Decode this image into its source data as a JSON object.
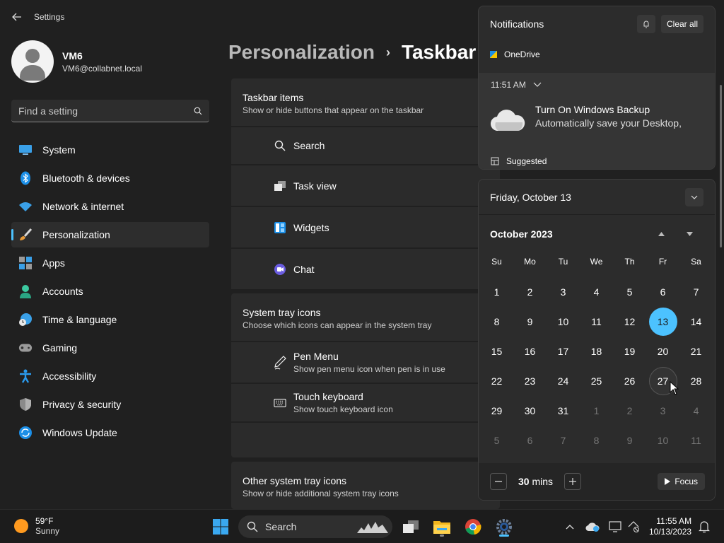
{
  "window": {
    "title": "Settings"
  },
  "profile": {
    "name": "VM6",
    "email": "VM6@collabnet.local"
  },
  "search": {
    "placeholder": "Find a setting"
  },
  "sidebar": {
    "items": [
      {
        "label": "System",
        "icon": "monitor-icon"
      },
      {
        "label": "Bluetooth & devices",
        "icon": "bluetooth-icon"
      },
      {
        "label": "Network & internet",
        "icon": "wifi-icon"
      },
      {
        "label": "Personalization",
        "icon": "brush-icon",
        "active": true
      },
      {
        "label": "Apps",
        "icon": "apps-icon"
      },
      {
        "label": "Accounts",
        "icon": "person-icon"
      },
      {
        "label": "Time & language",
        "icon": "clock-globe-icon"
      },
      {
        "label": "Gaming",
        "icon": "gamepad-icon"
      },
      {
        "label": "Accessibility",
        "icon": "accessibility-icon"
      },
      {
        "label": "Privacy & security",
        "icon": "shield-icon"
      },
      {
        "label": "Windows Update",
        "icon": "update-icon"
      }
    ]
  },
  "header": {
    "parent": "Personalization",
    "current": "Taskbar"
  },
  "taskbar_items": {
    "title": "Taskbar items",
    "subtitle": "Show or hide buttons that appear on the taskbar",
    "rows": [
      "Search",
      "Task view",
      "Widgets",
      "Chat"
    ]
  },
  "tray_icons": {
    "title": "System tray icons",
    "subtitle": "Choose which icons can appear in the system tray",
    "pen_title": "Pen Menu",
    "pen_sub": "Show pen menu icon when pen is in use",
    "kb_title": "Touch keyboard",
    "kb_sub": "Show touch keyboard icon"
  },
  "other_tray": {
    "title": "Other system tray icons",
    "subtitle": "Show or hide additional system tray icons"
  },
  "notifications": {
    "title": "Notifications",
    "clear_all": "Clear all",
    "app": "OneDrive",
    "time": "11:51 AM",
    "toast_title": "Turn On Windows Backup",
    "toast_body": "Automatically save your Desktop,",
    "suggested": "Suggested"
  },
  "calendar": {
    "date": "Friday, October 13",
    "month": "October 2023",
    "dow": [
      "Su",
      "Mo",
      "Tu",
      "We",
      "Th",
      "Fr",
      "Sa"
    ],
    "weeks": [
      [
        "1",
        "2",
        "3",
        "4",
        "5",
        "6",
        "7"
      ],
      [
        "8",
        "9",
        "10",
        "11",
        "12",
        "13",
        "14"
      ],
      [
        "15",
        "16",
        "17",
        "18",
        "19",
        "20",
        "21"
      ],
      [
        "22",
        "23",
        "24",
        "25",
        "26",
        "27",
        "28"
      ],
      [
        "29",
        "30",
        "31",
        "1",
        "2",
        "3",
        "4"
      ],
      [
        "5",
        "6",
        "7",
        "8",
        "9",
        "10",
        "11"
      ]
    ],
    "today": "13",
    "focus_value": "30",
    "focus_unit": "mins",
    "focus_label": "Focus",
    "accent": "#4cc2ff"
  },
  "taskbar": {
    "temp": "59°F",
    "condition": "Sunny",
    "search_label": "Search",
    "time": "11:55 AM",
    "date": "10/13/2023"
  }
}
